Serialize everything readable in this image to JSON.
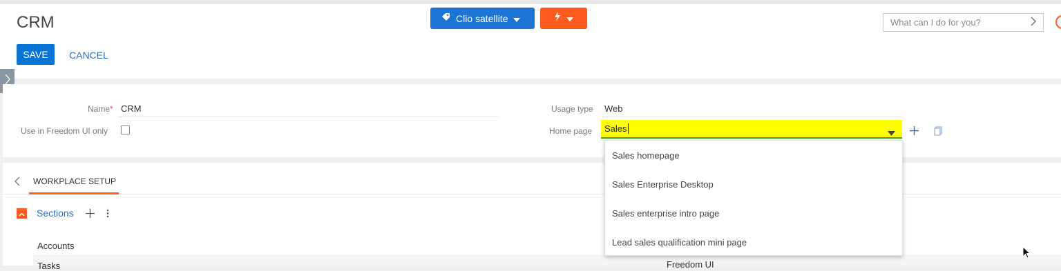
{
  "header": {
    "title": "CRM",
    "save_label": "SAVE",
    "cancel_label": "CANCEL",
    "workplace_button": "Clio satellite",
    "search_placeholder": "What can I do for you?"
  },
  "form": {
    "name_label": "Name",
    "name_required_mark": "*",
    "name_value": "CRM",
    "freedom_label": "Use in Freedom UI only",
    "freedom_checked": false,
    "usage_label": "Usage type",
    "usage_value": "Web",
    "home_label": "Home page",
    "home_value": "Sales"
  },
  "dropdown": {
    "options": [
      "Sales homepage",
      "Sales Enterprise Desktop",
      "Sales enterprise intro page",
      "Lead sales qualification mini page"
    ]
  },
  "tabs": {
    "active": "WORKPLACE SETUP"
  },
  "sections": {
    "label": "Sections",
    "rows": [
      {
        "name": "Accounts",
        "type": ""
      },
      {
        "name": "Tasks",
        "type": "Freedom UI"
      }
    ]
  },
  "colors": {
    "accent_blue": "#1c74d4",
    "accent_orange": "#ff5b1e",
    "highlight_yellow": "#ffff00"
  }
}
